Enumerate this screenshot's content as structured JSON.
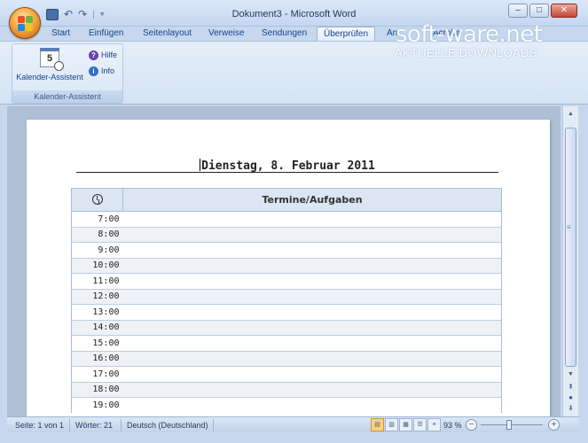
{
  "window": {
    "title": "Dokument3 - Microsoft Word",
    "controls": {
      "minimize": "–",
      "maximize": "□",
      "close": "✕"
    }
  },
  "quick_access": {
    "undo": "↶",
    "redo": "↷",
    "separator": "|",
    "customize": "▾"
  },
  "tabs": [
    "Start",
    "Einfügen",
    "Seitenlayout",
    "Verweise",
    "Sendungen",
    "Überprüfen",
    "An",
    "Acroba"
  ],
  "active_tab": "Überprüfen",
  "ribbon": {
    "group_label": "Kalender-Assistent",
    "main_button": {
      "label": "Kalender-Assistent",
      "icon_number": "5"
    },
    "help_button": {
      "label": "Hilfe",
      "glyph": "?"
    },
    "info_button": {
      "label": "Info",
      "glyph": "i"
    }
  },
  "watermark": {
    "brand": "soft-ware.net",
    "tagline": "AKTUELLE DOWNLOADS"
  },
  "document": {
    "heading": "Dienstag,  8. Februar 2011",
    "table": {
      "header": "Termine/Aufgaben",
      "times": [
        "7:00",
        "8:00",
        "9:00",
        "10:00",
        "11:00",
        "12:00",
        "13:00",
        "14:00",
        "15:00",
        "16:00",
        "17:00",
        "18:00",
        "19:00"
      ]
    }
  },
  "statusbar": {
    "page": "Seite: 1 von 1",
    "words": "Wörter: 21",
    "language": "Deutsch (Deutschland)",
    "zoom": "93 %",
    "zoom_minus": "−",
    "zoom_plus": "+"
  },
  "colors": {
    "accent": "#15428b",
    "table_header_bg": "#dce6f2",
    "alt_row_bg": "#eef1f5",
    "office_orb": "#f5a940"
  }
}
